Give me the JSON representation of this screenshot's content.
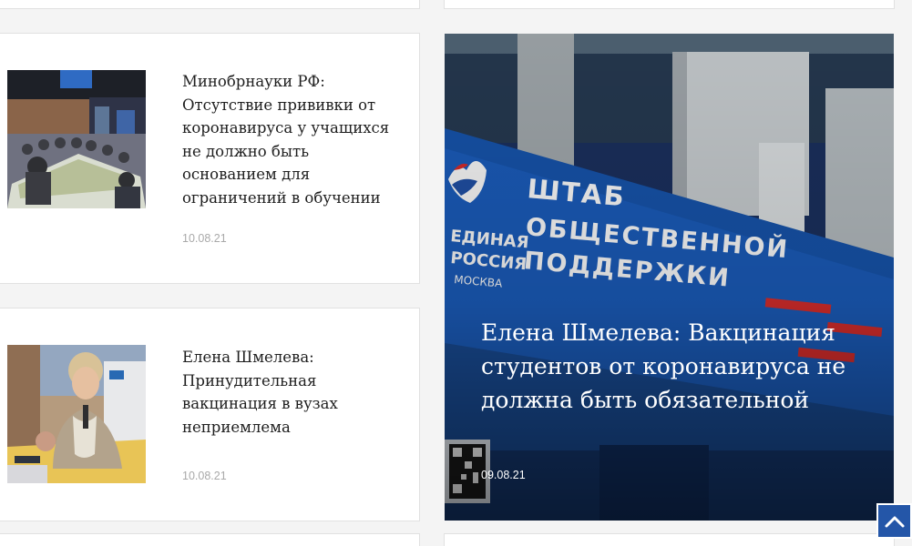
{
  "news": [
    {
      "headline": "Минобрнауки РФ: Отсутствие прививки от коронавируса у учащихся не должно быть основанием для ограничений в обучении",
      "date": "10.08.21"
    },
    {
      "headline": "Елена Шмелева: Принудительная вакцинация в вузах неприемлема",
      "date": "10.08.21"
    }
  ],
  "featured": {
    "headline": "Елена Шмелева: Вакцинация студентов от коронавируса не должна быть обязательной",
    "date": "09.08.21",
    "sign_text": [
      "ШТАБ",
      "ОБЩЕСТВЕННОЙ",
      "ПОДДЕРЖКИ"
    ],
    "logo_text": [
      "ЕДИНАЯ",
      "РОССИЯ",
      "МОСКВА"
    ]
  },
  "scroll_top": {
    "icon": "chevron-up-icon",
    "accent": "#2456a8"
  }
}
